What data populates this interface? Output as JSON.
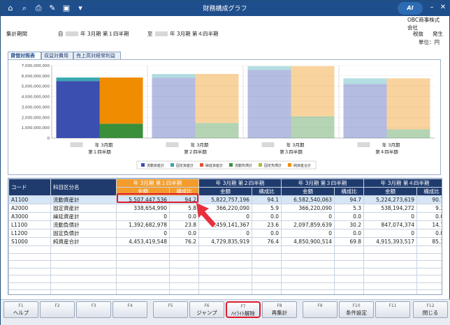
{
  "titlebar": {
    "title": "財務構成グラフ"
  },
  "header": {
    "period_label": "集計期間",
    "from_label": "自",
    "from_text": "年  3月期 第１四半期",
    "to_label": "至",
    "to_text": "年  3月期 第４四半期",
    "company": "OBC商事株式会社",
    "tax_label": "税抜",
    "basis_label": "発生",
    "unit_label": "単位：円"
  },
  "tabs": [
    {
      "label": "貸借対照表"
    },
    {
      "label": "収益対費用"
    },
    {
      "label": "売上高対経常利益"
    }
  ],
  "chart_data": {
    "type": "bar",
    "categories": [
      "年  3月期 第１四半期",
      "年  3月期 第２四半期",
      "年  3月期 第３四半期",
      "年  3月期 第４四半期"
    ],
    "ylim": [
      0,
      7000000000
    ],
    "yticks": [
      "7,000,000,000",
      "6,000,000,000",
      "5,000,000,000",
      "4,000,000,000",
      "3,000,000,000",
      "2,000,000,000",
      "1,000,000,000",
      "0"
    ],
    "series": [
      {
        "name": "流動資産計",
        "color": "#3b4fb0",
        "values": [
          5507447536,
          5822757196,
          6582540063,
          5224273619
        ]
      },
      {
        "name": "固定資産計",
        "color": "#3aa7b0",
        "values": [
          338654990,
          366220090,
          366220090,
          538194272
        ]
      },
      {
        "name": "繰延資産計",
        "color": "#e0503a",
        "values": [
          0,
          0,
          0,
          0
        ]
      },
      {
        "name": "流動負債計",
        "color": "#3a8f3a",
        "values": [
          1392682978,
          1459141367,
          2097859639,
          847074374
        ]
      },
      {
        "name": "固定負債計",
        "color": "#a0c040",
        "values": [
          0,
          0,
          0,
          0
        ]
      },
      {
        "name": "純資産合計",
        "color": "#f08c00",
        "values": [
          4453419548,
          4729835919,
          4850900514,
          4915393517
        ]
      }
    ]
  },
  "grid": {
    "col_code": "コード",
    "col_name": "科目区分名",
    "periods": [
      "年  3月期 第１四半期",
      "年  3月期 第２四半期",
      "年  3月期 第３四半期",
      "年  3月期 第４四半期"
    ],
    "sub_amount": "金額",
    "sub_ratio": "構成比",
    "rows": [
      {
        "code": "A1100",
        "name": "流動資産計",
        "v": [
          "5,507,447,536",
          "94.2",
          "5,822,757,196",
          "94.1",
          "6,582,540,063",
          "94.7",
          "5,224,273,619",
          "90.7"
        ]
      },
      {
        "code": "A2000",
        "name": "固定資産計",
        "v": [
          "338,654,990",
          "5.8",
          "366,220,090",
          "5.9",
          "366,220,090",
          "5.3",
          "538,194,272",
          "9.3"
        ]
      },
      {
        "code": "A3000",
        "name": "繰延資産計",
        "v": [
          "0",
          "0.0",
          "0",
          "0.0",
          "0",
          "0.0",
          "0",
          "0.0"
        ]
      },
      {
        "code": "L1100",
        "name": "流動負債計",
        "v": [
          "1,392,682,978",
          "23.8",
          "1,459,141,367",
          "23.6",
          "2,097,859,639",
          "30.2",
          "847,074,374",
          "14.7"
        ]
      },
      {
        "code": "L1200",
        "name": "固定負債計",
        "v": [
          "0",
          "0.0",
          "0",
          "0.0",
          "0",
          "0.0",
          "0",
          "0.0"
        ]
      },
      {
        "code": "S1000",
        "name": "純資産合計",
        "v": [
          "4,453,419,548",
          "76.2",
          "4,729,835,919",
          "76.4",
          "4,850,900,514",
          "69.8",
          "4,915,393,517",
          "85.3"
        ]
      }
    ]
  },
  "fkeys": [
    {
      "fn": "F1",
      "label": "ヘルプ"
    },
    {
      "fn": "F2",
      "label": ""
    },
    {
      "fn": "F3",
      "label": ""
    },
    {
      "fn": "F4",
      "label": ""
    },
    {
      "fn": "F5",
      "label": ""
    },
    {
      "fn": "F6",
      "label": "ジャンプ"
    },
    {
      "fn": "F7",
      "label": "ﾊｲﾗｲﾄ解除"
    },
    {
      "fn": "F8",
      "label": "再集計"
    },
    {
      "fn": "F9",
      "label": ""
    },
    {
      "fn": "F10",
      "label": "条件設定"
    },
    {
      "fn": "F11",
      "label": ""
    },
    {
      "fn": "F12",
      "label": "閉じる"
    }
  ]
}
